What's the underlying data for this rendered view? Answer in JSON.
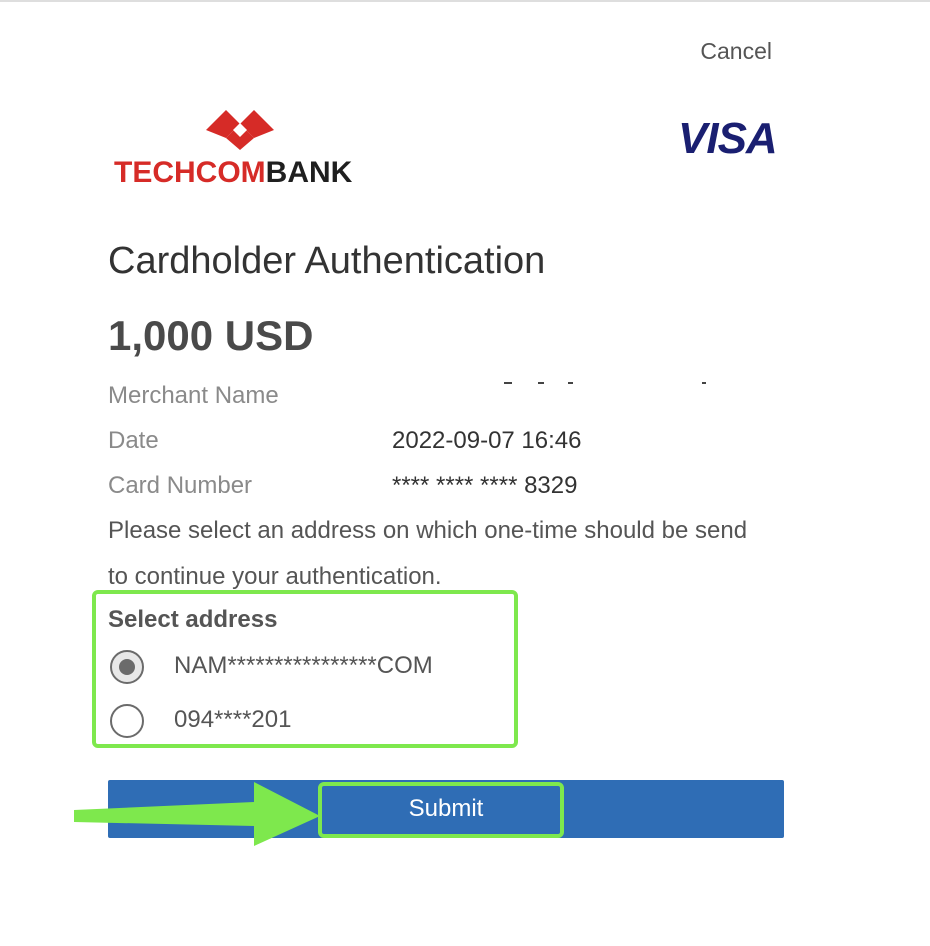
{
  "header": {
    "cancel_label": "Cancel",
    "bank_name_part1": "TECHCOM",
    "bank_name_part2": "BANK",
    "card_brand": "VISA"
  },
  "main": {
    "title": "Cardholder Authentication",
    "amount": "1,000 USD",
    "details": {
      "merchant_label": "Merchant Name",
      "merchant_value": "",
      "date_label": "Date",
      "date_value": "2022-09-07 16:46",
      "card_label": "Card Number",
      "card_value": "**** **** **** 8329"
    },
    "instructions": "Please select an address on which one-time should be send to continue your authentication.",
    "select_address_label": "Select address",
    "addresses": [
      {
        "label": "NAM****************COM",
        "selected": true
      },
      {
        "label": "094****201",
        "selected": false
      }
    ],
    "submit_label": "Submit"
  },
  "colors": {
    "brand_red": "#d62b27",
    "visa_blue": "#1a1f71",
    "submit_blue": "#2f6db5",
    "highlight_green": "#7ee84d"
  },
  "icons": {
    "bank_mark": "techcombank-diamond-icon",
    "arrow": "arrow-right-icon",
    "radio_checked": "radio-checked-icon",
    "radio_unchecked": "radio-unchecked-icon"
  }
}
